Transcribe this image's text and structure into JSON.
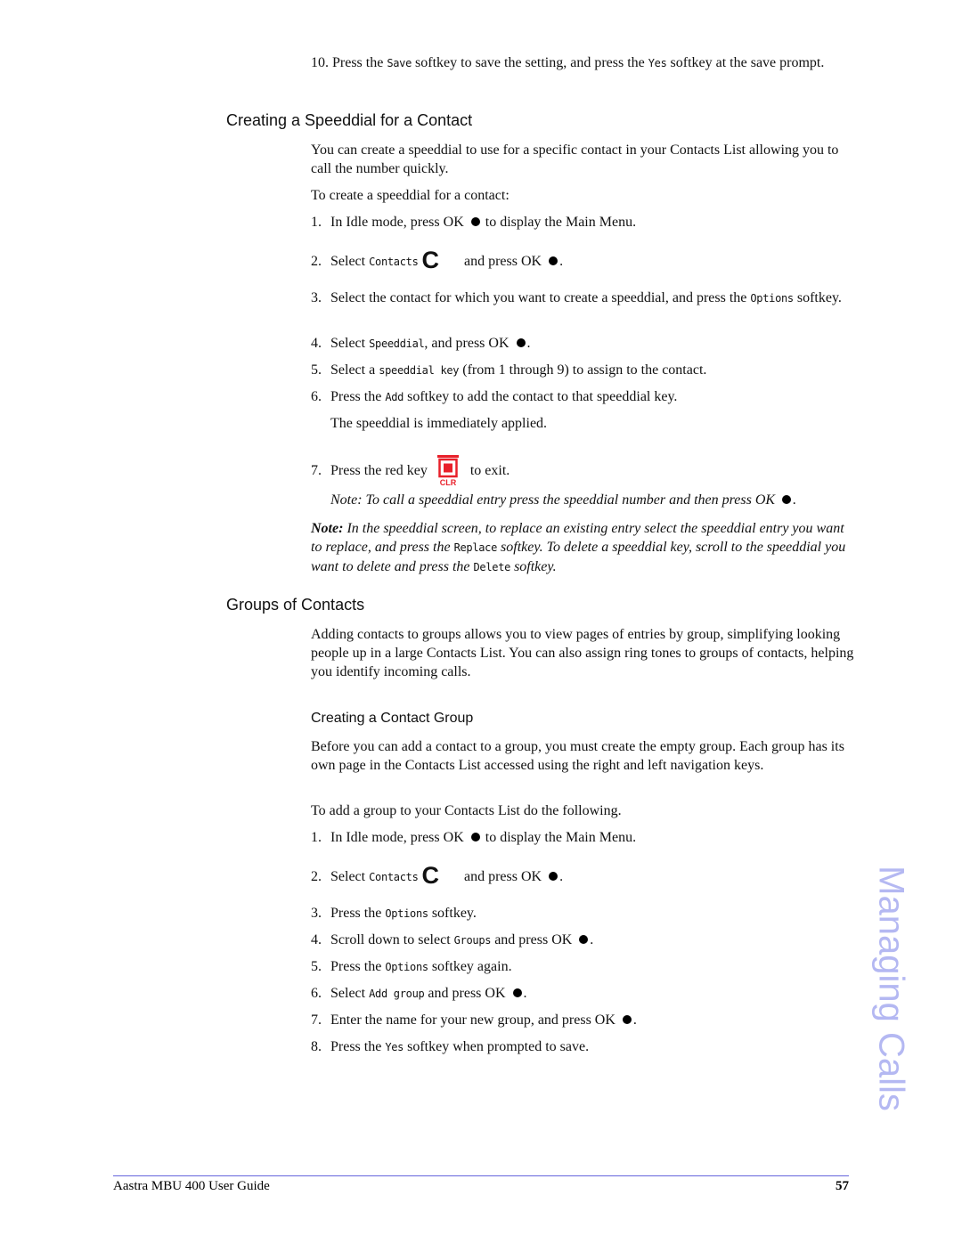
{
  "intro_step": {
    "number": "10.",
    "parts": [
      "Press the ",
      "Save",
      " softkey to save the setting, and press the ",
      "Yes",
      " softkey at the save prompt."
    ]
  },
  "section1": {
    "heading": "Creating a Speeddial for a Contact",
    "paragraph": "You can create a speeddial to use for a specific contact in your Contacts List allowing you to call the number quickly.",
    "lead": "To create a speeddial for a contact:",
    "steps": [
      {
        "number": "1.",
        "before": "In Idle mode, press OK ",
        "after": " to display the Main Menu."
      },
      {
        "number": "2.",
        "before": "Select ",
        "softkey": "Contacts",
        "icon_letter": "C",
        "after": "and press OK ",
        "end": "."
      },
      {
        "number": "3.",
        "before": "Select the contact for which you want to create a speeddial, and press the ",
        "softkey": "Options",
        "after": " softkey."
      },
      {
        "number": "4.",
        "before": "Select ",
        "softkey": "Speeddial",
        "after": ", and press OK ",
        "end": "."
      },
      {
        "number": "5.",
        "before": "Select a ",
        "softkey": "speeddial key",
        "after": " (from 1 through 9) to assign to the contact."
      },
      {
        "number": "6.",
        "before": "Press the ",
        "softkey": "Add",
        "after": " softkey to add the contact to that speeddial key."
      },
      {
        "number": "",
        "text": "The speeddial is immediately applied."
      },
      {
        "number": "7.",
        "before": "Press the red key",
        "icon_label": "CLR",
        "after": "to exit."
      }
    ],
    "note1": "Note: To call a speeddial entry press the speeddial number and then press OK ",
    "note2": {
      "label": "Note:",
      "parts": [
        " In the speeddial screen, to replace an existing entry select the speeddial entry you want to replace, and press the ",
        "Replace",
        " softkey. To delete a speeddial key, scroll to the speeddial you want to delete and press the ",
        "Delete",
        " softkey."
      ]
    }
  },
  "section2": {
    "heading": "Groups of Contacts",
    "paragraph": "Adding contacts to groups allows you to view pages of entries by group, simplifying looking people up in a large Contacts List. You can also assign ring tones to groups of contacts, helping you identify incoming calls.",
    "subheading": "Creating a Contact Group",
    "sub_paragraph": "Before you can add a contact to a group, you must create the empty group. Each group has its own page in the Contacts List accessed using the right and left navigation keys.",
    "lead": "To add a group to your Contacts List do the following.",
    "steps": [
      {
        "number": "1.",
        "before": "In Idle mode, press OK ",
        "after": " to display the Main Menu."
      },
      {
        "number": "2.",
        "before": "Select ",
        "softkey": "Contacts",
        "icon_letter": "C",
        "after": "and press OK ",
        "end": "."
      },
      {
        "number": "3.",
        "before": "Press the ",
        "softkey": "Options",
        "after": " softkey."
      },
      {
        "number": "4.",
        "before": "Scroll down to select ",
        "softkey": "Groups",
        "after": " and press OK ",
        "end": "."
      },
      {
        "number": "5.",
        "before": "Press the ",
        "softkey": "Options",
        "after": " softkey again."
      },
      {
        "number": "6.",
        "before": "Select ",
        "softkey": "Add group",
        "after": " and press OK ",
        "end": "."
      },
      {
        "number": "7.",
        "before": "Enter the name for your new group, and press OK ",
        "end": "."
      },
      {
        "number": "8.",
        "before": "Press the ",
        "softkey": "Yes",
        "after": " softkey when prompted to save."
      }
    ]
  },
  "side_tab": "Managing Calls",
  "footer": {
    "title": "Aastra MBU 400 User Guide",
    "page_number": "57"
  },
  "colors": {
    "accent_red": "#e8202a",
    "watermark": "#b4b8f2",
    "footer_rule": "#6666dd"
  }
}
